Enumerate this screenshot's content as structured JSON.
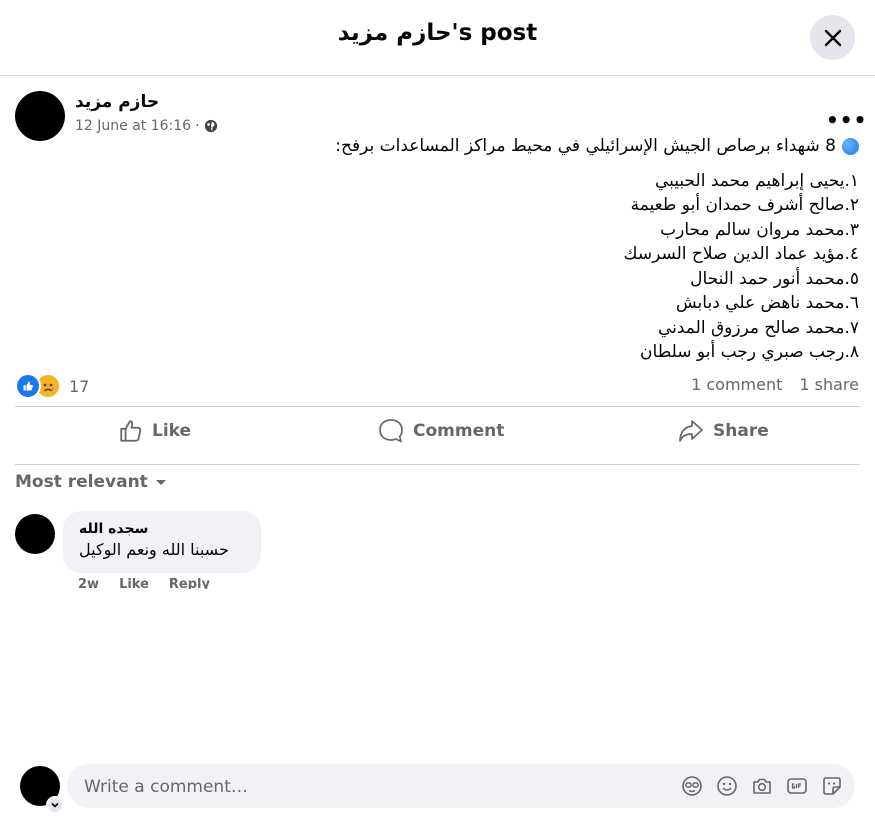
{
  "header": {
    "title": "حازم مزيد's post"
  },
  "post": {
    "author": "حازم مزيد",
    "timestamp": "12 June at 16:16",
    "meta_separator": "·",
    "intro": "8 شهداء برصاص الجيش الإسرائيلي في محيط مراكز المساعدات برفح:",
    "lines": [
      "١.يحيى إبراهيم محمد الحبيبي",
      "٢.صالح أشرف حمدان أبو طعيمة",
      "٣.محمد مروان سالم محارب",
      "٤.مؤيد عماد الدين صلاح السرسك",
      "٥.محمد أنور حمد النحال",
      "٦.محمد ناهض علي دبابش",
      "٧.محمد صالح مرزوق المدني",
      "٨.رجب صبري رجب أبو سلطان"
    ],
    "reaction_count": "17",
    "comment_count": "1 comment",
    "share_count": "1 share"
  },
  "actions": {
    "like": "Like",
    "comment": "Comment",
    "share": "Share"
  },
  "sort": {
    "label": "Most relevant"
  },
  "comment": {
    "author": "سجده الله",
    "text": "حسبنا الله ونعم الوكيل",
    "time": "2w",
    "like": "Like",
    "reply": "Reply"
  },
  "composer": {
    "placeholder": "Write a comment…"
  },
  "colors": {
    "accent": "#1877f2",
    "text_secondary": "#65676b",
    "surface": "#f0f2f5"
  }
}
